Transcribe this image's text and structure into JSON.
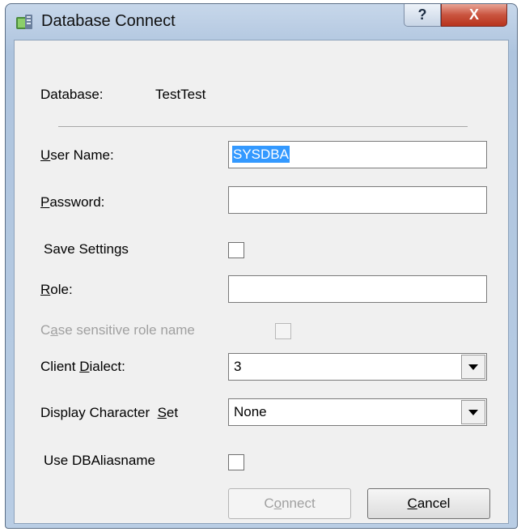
{
  "window": {
    "title": "Database Connect",
    "help_glyph": "?",
    "close_glyph": "X",
    "icon": "database-connect-icon"
  },
  "database": {
    "label": "Database:",
    "value": "TestTest"
  },
  "user_name": {
    "label_prefix": "",
    "label_mnemonic": "U",
    "label_rest": "ser Name:",
    "value": "SYSDBA"
  },
  "password": {
    "label_mnemonic": "P",
    "label_rest": "assword:",
    "value": ""
  },
  "save_settings": {
    "label": "Save Settings",
    "checked": false
  },
  "role": {
    "label_mnemonic": "R",
    "label_rest": "ole:",
    "value": ""
  },
  "case_sensitive_role": {
    "label_prefix": "C",
    "label_mnemonic": "a",
    "label_rest": "se sensitive role name",
    "checked": false,
    "enabled": false
  },
  "client_dialect": {
    "label_prefix": "Client ",
    "label_mnemonic": "D",
    "label_rest": "ialect:",
    "value": "3"
  },
  "display_charset": {
    "label_prefix": "Display Character  ",
    "label_mnemonic": "S",
    "label_rest": "et",
    "value": "None"
  },
  "use_dbaliasname": {
    "label": "Use DBAliasname",
    "checked": false
  },
  "buttons": {
    "connect_prefix": "C",
    "connect_mnemonic": "o",
    "connect_rest": "nnect",
    "cancel_mnemonic": "C",
    "cancel_rest": "ancel"
  }
}
